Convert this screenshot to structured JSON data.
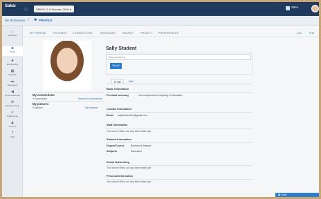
{
  "header": {
    "logo_text": "Sakai",
    "site_select": "SMWU 11.0 Summer 2016",
    "sites_label": "Sites",
    "colors": {
      "topbar": "#1f3a5c",
      "accent": "#2d7ecb"
    }
  },
  "breadcrumb": {
    "workspace": "My Workspace",
    "separator": "/",
    "current": "PROFILE"
  },
  "sidenav": {
    "items": [
      {
        "label": "Overview",
        "icon": "home-icon"
      },
      {
        "label": "Profile",
        "icon": "person-icon"
      },
      {
        "label": "Membership",
        "icon": "group-icon"
      },
      {
        "label": "Calendar",
        "icon": "calendar-icon"
      },
      {
        "label": "Resources",
        "icon": "folder-icon"
      },
      {
        "label": "Announcements",
        "icon": "megaphone-icon"
      },
      {
        "label": "Worksite Setup",
        "icon": "gear-icon"
      },
      {
        "label": "Preferences",
        "icon": "sliders-icon"
      },
      {
        "label": "Account",
        "icon": "user-icon"
      },
      {
        "label": "Help",
        "icon": "help-icon"
      }
    ]
  },
  "tools": {
    "items": [
      "MY PROFILE",
      "PICTURES",
      "CONNECTIONS",
      "MESSAGES",
      "SEARCH",
      "PRIVACY",
      "PREFERENCES"
    ],
    "right": [
      "Link",
      "Print"
    ]
  },
  "left": {
    "connections_title": "My connections",
    "connections_count": "0 connections",
    "connections_link": "Search for connections",
    "pictures_title": "My pictures",
    "pictures_count": "0 pictures",
    "pictures_link": "Add pictures"
  },
  "profile": {
    "name": "Sally Student",
    "status_placeholder": "Say something",
    "post_label": "Post it",
    "tabs": [
      "Profile",
      "Wall"
    ],
    "sections": {
      "basic_title": "Basic Information",
      "personal_summary_label": "Personal summary",
      "personal_summary_value": "I am a sophomore majoring in Education.",
      "contact_title": "Contact Information",
      "email_label": "Email",
      "email_value": "sallystudent01@gmail.com",
      "staff_title": "Staff Information",
      "staff_empty": "You haven't filled out any information yet",
      "student_title": "Student Information",
      "degree_label": "Degree/Course",
      "degree_value": "Bachelor's Degree",
      "subjects_label": "Subjects",
      "subjects_value": "Education",
      "social_title": "Social Networking",
      "social_empty": "You haven't filled out any information yet",
      "personal_title": "Personal Information",
      "personal_empty": "You haven't filled out any information yet"
    }
  },
  "chat": {
    "label": "Chat"
  }
}
